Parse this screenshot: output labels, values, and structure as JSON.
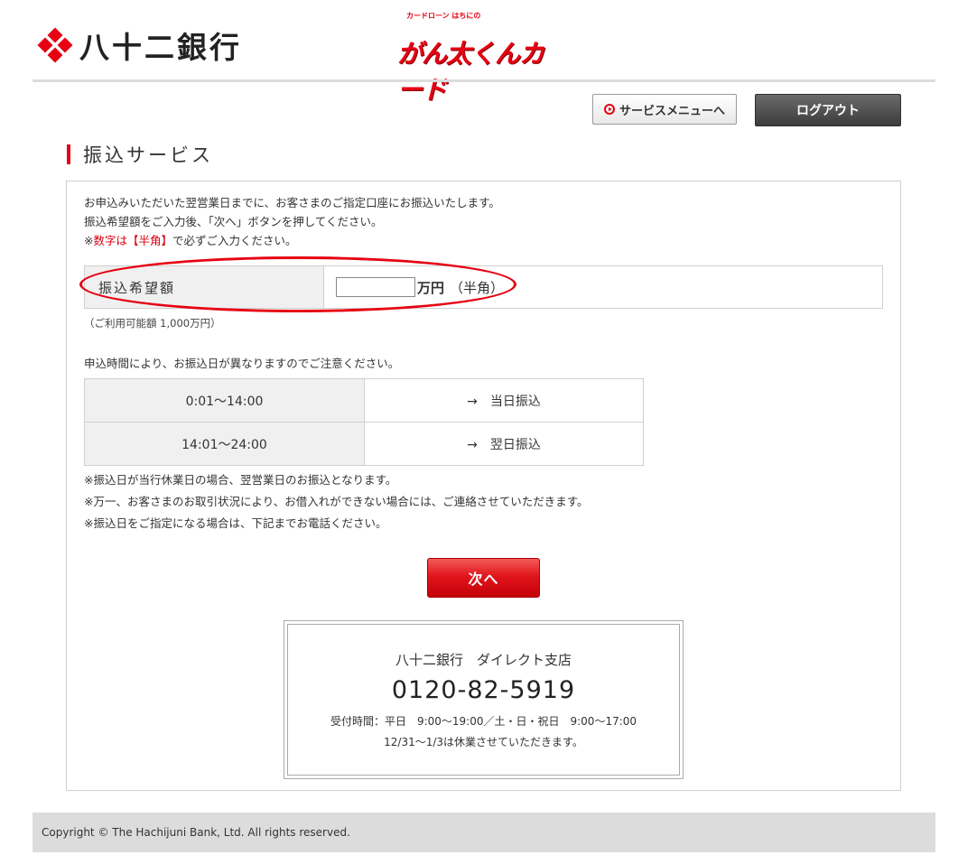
{
  "header": {
    "bank_name": "八十二銀行",
    "card_sub": "カードローン はちにの",
    "card_name": "がん太くんカード"
  },
  "nav": {
    "service_menu": "サービスメニューへ",
    "logout": "ログアウト"
  },
  "page": {
    "title": "振込サービス"
  },
  "intro": {
    "line1": "お申込みいただいた翌営業日までに、お客さまのご指定口座にお振込いたします。",
    "line2": "振込希望額をご入力後、「次へ」ボタンを押してください。",
    "line3_prefix": "※",
    "line3_red": "数字は【半角】",
    "line3_suffix": "で必ずご入力ください。"
  },
  "amount": {
    "label": "振込希望額",
    "value": "",
    "unit": "万円",
    "note": "（半角）",
    "available": "（ご利用可能額 1,000万円）"
  },
  "schedule": {
    "notice": "申込時間により、お振込日が異なりますのでご注意ください。",
    "rows": [
      {
        "time": "0:01〜14:00",
        "result": "→　当日振込"
      },
      {
        "time": "14:01〜24:00",
        "result": "→　翌日振込"
      }
    ]
  },
  "notes": [
    "※振込日が当行休業日の場合、翌営業日のお振込となります。",
    "※万一、お客さまのお取引状況により、お借入れができない場合には、ご連絡させていただきます。",
    "※振込日をご指定になる場合は、下記までお電話ください。"
  ],
  "next_button": "次へ",
  "contact": {
    "branch": "八十二銀行　ダイレクト支店",
    "phone": "0120-82-5919",
    "hours": "受付時間：平日　9:00〜19:00／土・日・祝日　9:00〜17:00",
    "holiday": "12/31〜1/3は休業させていただきます。"
  },
  "footer": {
    "copyright": "Copyright © The Hachijuni Bank, Ltd. All rights reserved."
  },
  "colors": {
    "accent": "#e60012",
    "footer_bg": "#dcdcdc"
  },
  "icons": {
    "service_menu": "circle-arrow-right-icon",
    "logo": "diamond-cluster-logo-icon"
  }
}
